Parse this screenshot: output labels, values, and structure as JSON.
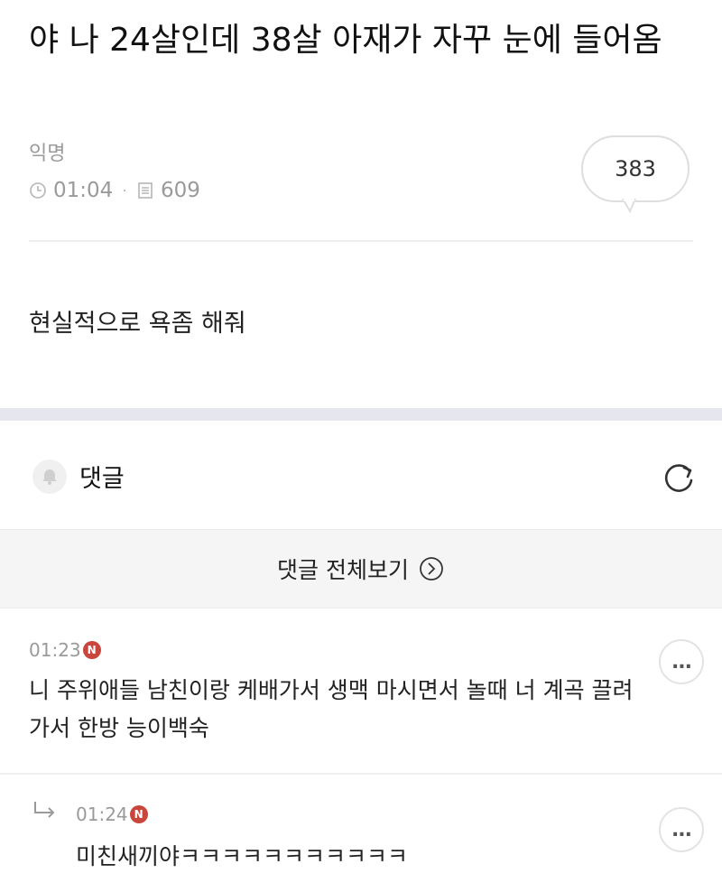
{
  "post": {
    "title": "야 나 24살인데 38살 아재가 자꾸 눈에 들어옴",
    "author": "익명",
    "time": "01:04",
    "views": "609",
    "comment_count": "383",
    "body": "현실적으로 욕좀 해줘"
  },
  "comments_section": {
    "label": "댓글",
    "view_all_label": "댓글 전체보기"
  },
  "comments": [
    {
      "time": "01:23",
      "badge": "N",
      "text": "니 주위애들 남친이랑 케배가서 생맥 마시면서 놀때 너 계곡 끌려가서 한방 능이백숙",
      "more": "..."
    },
    {
      "time": "01:24",
      "badge": "N",
      "text": "미친새끼야ㅋㅋㅋㅋㅋㅋㅋㅋㅋㅋㅋ",
      "more": "...",
      "is_reply": true
    }
  ],
  "colors": {
    "accent_badge": "#c9463d",
    "section_gap": "#e6e6ee",
    "muted_text": "#9a9a9a"
  },
  "icons": [
    "clock-icon",
    "document-icon",
    "bell-icon",
    "refresh-icon",
    "circle-chevron-right-icon",
    "reply-arrow-icon",
    "more-icon"
  ]
}
